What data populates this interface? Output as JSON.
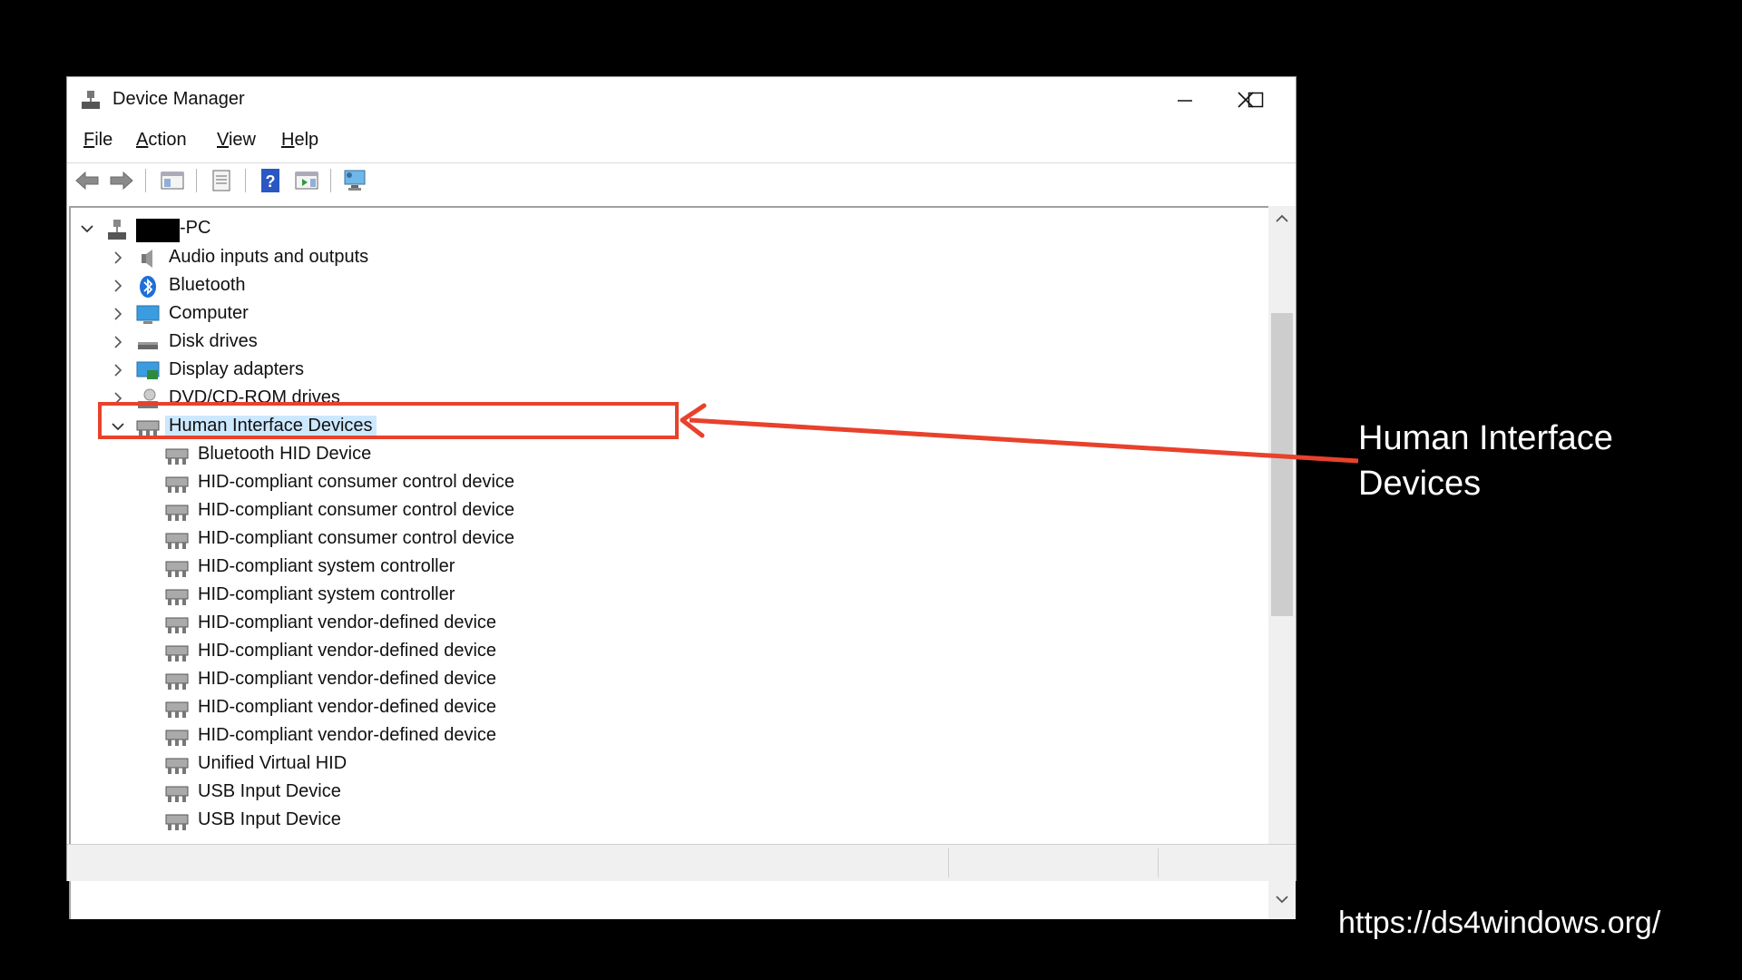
{
  "window": {
    "title": "Device Manager",
    "menu": [
      {
        "label": "File",
        "access": "F",
        "rest": "ile"
      },
      {
        "label": "Action",
        "access": "A",
        "rest": "ction"
      },
      {
        "label": "View",
        "access": "V",
        "rest": "iew"
      },
      {
        "label": "Help",
        "access": "H",
        "rest": "elp"
      }
    ]
  },
  "tree": {
    "root_label": "-PC",
    "categories": [
      {
        "label": "Audio inputs and outputs",
        "icon": "speaker-icon"
      },
      {
        "label": "Bluetooth",
        "icon": "bluetooth-icon"
      },
      {
        "label": "Computer",
        "icon": "monitor-icon"
      },
      {
        "label": "Disk drives",
        "icon": "disk-drive-icon"
      },
      {
        "label": "Display adapters",
        "icon": "display-adapter-icon"
      },
      {
        "label": "DVD/CD-ROM drives",
        "icon": "dvd-drive-icon"
      }
    ],
    "expanded_category": "Human Interface Devices",
    "hid_devices": [
      "Bluetooth HID Device",
      "HID-compliant consumer control device",
      "HID-compliant consumer control device",
      "HID-compliant consumer control device",
      "HID-compliant system controller",
      "HID-compliant system controller",
      "HID-compliant vendor-defined device",
      "HID-compliant vendor-defined device",
      "HID-compliant vendor-defined device",
      "HID-compliant vendor-defined device",
      "HID-compliant vendor-defined device",
      "Unified Virtual HID",
      "USB Input Device",
      "USB Input Device"
    ]
  },
  "annotation": {
    "line1": "Human Interface",
    "line2": "Devices"
  },
  "footer": {
    "url": "https://ds4windows.org/"
  },
  "colors": {
    "highlight": "#e8412c",
    "selection": "#cce8ff"
  }
}
